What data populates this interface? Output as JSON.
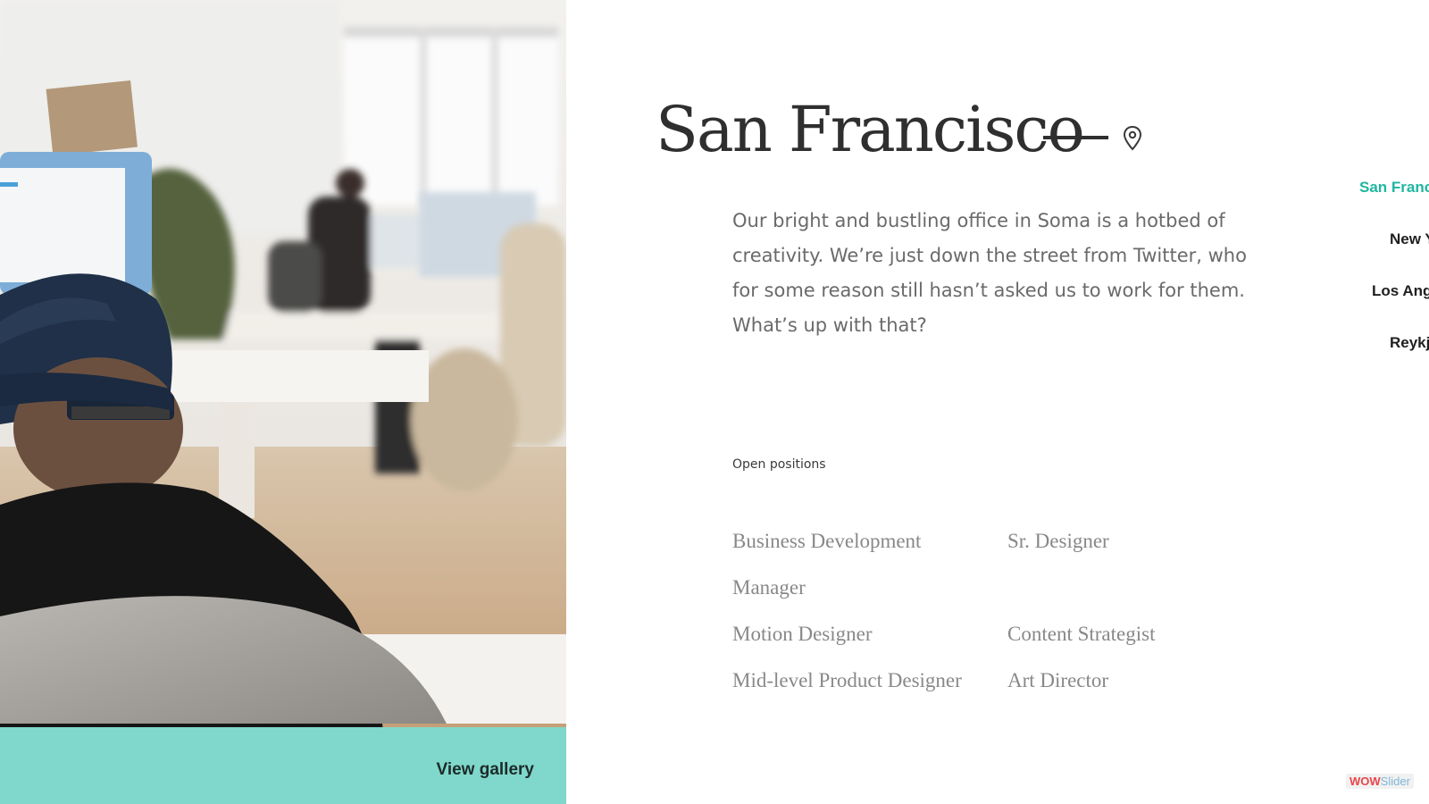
{
  "hero": {
    "gallery_label": "View gallery"
  },
  "office": {
    "title": "San Francisco",
    "description": "Our bright and bustling office in Soma is a hotbed of creativity. We’re just down the street from Twitter, who for some reason still hasn’t asked us to work for them. What’s up with that?",
    "open_positions_label": "Open positions",
    "positions": [
      "Business Development Manager",
      "Sr. Designer",
      "Motion Designer",
      "Content Strategist",
      "Mid-level Product Designer",
      "Art Director"
    ]
  },
  "city_nav": {
    "items": [
      {
        "label": "San Franc",
        "active": true
      },
      {
        "label": "New Y",
        "active": false
      },
      {
        "label": "Los Ang",
        "active": false
      },
      {
        "label": "Reykj",
        "active": false
      }
    ]
  },
  "badge": {
    "part1": "WOW",
    "part2": "Slider"
  },
  "colors": {
    "accent": "#20b6a0",
    "gallery_bar": "#7fd8cb",
    "title_text": "#2f2f2f",
    "body_text": "#6a6a6a"
  }
}
